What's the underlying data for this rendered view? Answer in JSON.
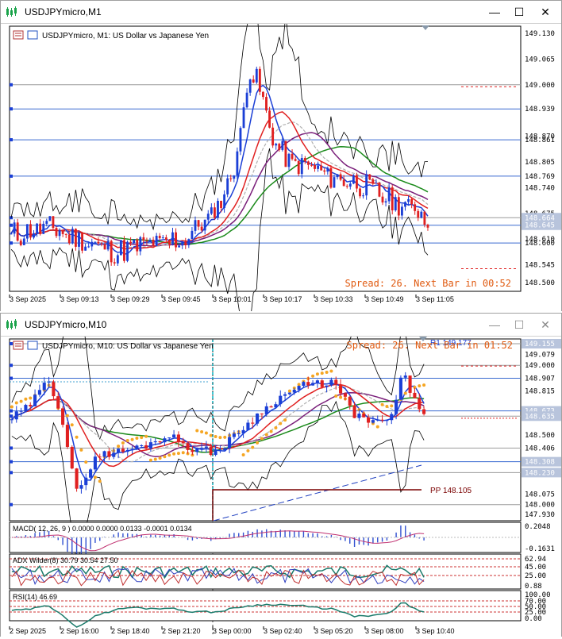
{
  "window1": {
    "title": "USDJPYmicro,M1",
    "header": "USDJPYmicro, M1:  US Dollar vs Japanese Yen",
    "spread_text": "Spread: 26. Next Bar in 00:52",
    "price_labels": [
      "149.130",
      "149.065",
      "149.000",
      "148.939",
      "148.870",
      "148.861",
      "148.805",
      "148.769",
      "148.740",
      "148.675",
      "148.664",
      "148.645",
      "148.610",
      "148.600",
      "148.545",
      "148.500"
    ],
    "time_labels": [
      "3 Sep 2025",
      "3 Sep 09:13",
      "3 Sep 09:29",
      "3 Sep 09:45",
      "3 Sep 10:01",
      "3 Sep 10:17",
      "3 Sep 10:33",
      "3 Sep 10:49",
      "3 Sep 11:05"
    ]
  },
  "window2": {
    "title": "USDJPYmicro,M10",
    "header": "USDJPYmicro, M10:  US Dollar vs Japanese Yen",
    "spread_text": "Spread: 26. Next Bar in 01:52",
    "r1_text": "R1 149.177",
    "pp_text": "PP 148.105",
    "price_labels": [
      "149.155",
      "149.079",
      "149.000",
      "148.907",
      "148.815",
      "148.673",
      "148.635",
      "148.500",
      "148.406",
      "148.308",
      "148.230",
      "148.075",
      "148.000",
      "147.930"
    ],
    "time_labels": [
      "2 Sep 2025",
      "2 Sep 16:00",
      "2 Sep 18:40",
      "2 Sep 21:20",
      "3 Sep 00:00",
      "3 Sep 02:40",
      "3 Sep 05:20",
      "3 Sep 08:00",
      "3 Sep 10:40"
    ],
    "macd": {
      "label": "MACD( 12, 26, 9 ) 0.0000 0.0000 0.0133 -0.0001 0.0134",
      "scale_top": "0.2048",
      "scale_bottom": "-0.1631"
    },
    "adx": {
      "label": "ADX Wilder(8) 30.79 30.54 27.50",
      "scale": [
        "62.94",
        "45.00",
        "25.00",
        "0.88"
      ]
    },
    "rsi": {
      "label": "RSI(14) 46.69",
      "scale": [
        "100.00",
        "70.00",
        "50.00",
        "25.00",
        "0.00"
      ]
    }
  },
  "colors": {
    "bull": "#1b3fd6",
    "bear": "#e02020",
    "spread": "#e05a10",
    "green_ma": "#1a8a1a",
    "purple_ma": "#7a1f7a",
    "band": "#000000",
    "psar": "#f5a623",
    "pp": "#7a0000"
  }
}
